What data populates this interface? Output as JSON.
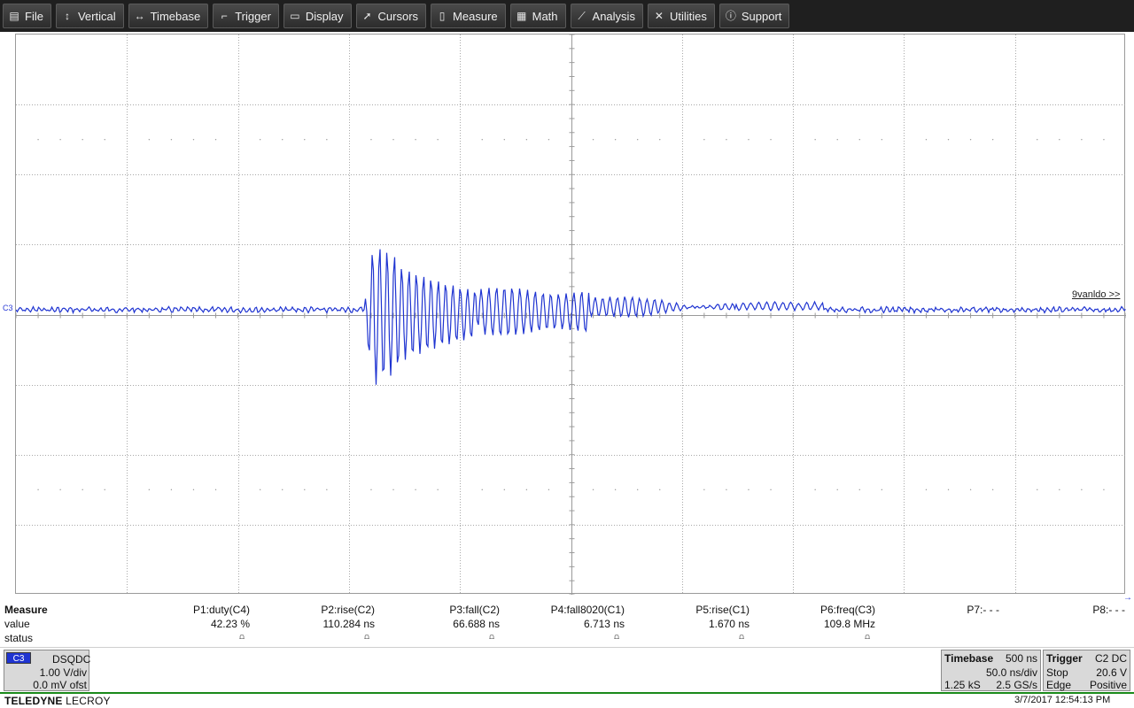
{
  "menu": [
    {
      "label": "File",
      "icon": "file-icon",
      "glyph": "▤"
    },
    {
      "label": "Vertical",
      "icon": "vertical-arrows-icon",
      "glyph": "↕"
    },
    {
      "label": "Timebase",
      "icon": "horizontal-arrows-icon",
      "glyph": "↔"
    },
    {
      "label": "Trigger",
      "icon": "trigger-icon",
      "glyph": "⌐"
    },
    {
      "label": "Display",
      "icon": "display-icon",
      "glyph": "▭"
    },
    {
      "label": "Cursors",
      "icon": "cursor-icon",
      "glyph": "➚"
    },
    {
      "label": "Measure",
      "icon": "measure-icon",
      "glyph": "▯"
    },
    {
      "label": "Math",
      "icon": "calculator-icon",
      "glyph": "▦"
    },
    {
      "label": "Analysis",
      "icon": "analysis-graph-icon",
      "glyph": "⟋"
    },
    {
      "label": "Utilities",
      "icon": "wrench-icon",
      "glyph": "✕"
    },
    {
      "label": "Support",
      "icon": "info-icon",
      "glyph": "ⓘ"
    }
  ],
  "grid": {
    "channel_marker": "C3",
    "offscreen_label": "9vanldo >>",
    "trace_color": "#1f34d1"
  },
  "measure": {
    "title": "Measure",
    "row_labels": [
      "value",
      "status"
    ],
    "params": [
      {
        "name": "P1:duty(C4)",
        "value": "42.23 %",
        "status": "⩍"
      },
      {
        "name": "P2:rise(C2)",
        "value": "110.284 ns",
        "status": "⩍"
      },
      {
        "name": "P3:fall(C2)",
        "value": "66.688 ns",
        "status": "⩍"
      },
      {
        "name": "P4:fall8020(C1)",
        "value": "6.713 ns",
        "status": "⩍"
      },
      {
        "name": "P5:rise(C1)",
        "value": "1.670 ns",
        "status": "⩍"
      },
      {
        "name": "P6:freq(C3)",
        "value": "109.8 MHz",
        "status": "⩍"
      },
      {
        "name": "P7:- - -",
        "value": "",
        "status": ""
      },
      {
        "name": "P8:- - -",
        "value": "",
        "status": ""
      }
    ]
  },
  "channel": {
    "badge": "C3",
    "coupling": "DSQ",
    "mode": "DC",
    "scale": "1.00 V/div",
    "offset": "0.0 mV ofst"
  },
  "timebase": {
    "title": "Timebase",
    "delay": "500 ns",
    "scale": "50.0 ns/div",
    "points": "1.25 kS",
    "rate": "2.5 GS/s"
  },
  "trigger": {
    "title": "Trigger",
    "source": "C2",
    "coupling": "DC",
    "mode": "Stop",
    "level": "20.6 V",
    "type": "Edge",
    "slope": "Positive"
  },
  "footer": {
    "brand_bold": "TELEDYNE",
    "brand_light": "LECROY",
    "timestamp": "3/7/2017 12:54:13 PM"
  }
}
